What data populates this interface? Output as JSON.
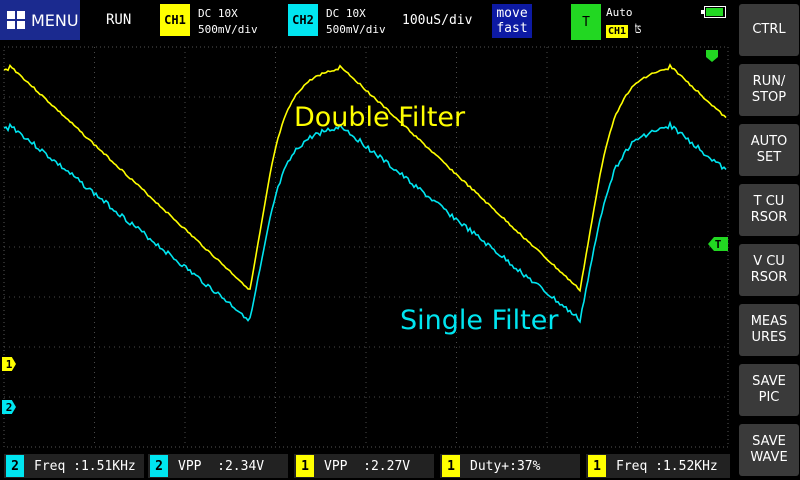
{
  "header": {
    "menu_label": "MENU",
    "run_state": "RUN",
    "ch1": {
      "badge": "CH1",
      "coupling": "DC  10X",
      "scale": "500mV/div",
      "color": "#ffff00"
    },
    "ch2": {
      "badge": "CH2",
      "coupling": "DC  10X",
      "scale": "500mV/div",
      "color": "#00e5f0"
    },
    "timebase": "100uS/div",
    "move_mode": [
      "move",
      "fast"
    ],
    "trigger": {
      "badge": "T",
      "mode": "Auto",
      "channel": "CH1",
      "edge_symbol": "ʦ",
      "color": "#22d722"
    }
  },
  "screen": {
    "labels": {
      "double": "Double Filter",
      "single": "Single Filter"
    },
    "markers": {
      "ch1": "1",
      "ch2": "2",
      "trigger": "T"
    }
  },
  "sidebar": {
    "buttons": [
      {
        "id": "ctrl",
        "label": "CTRL"
      },
      {
        "id": "run-stop",
        "label": "RUN/\nSTOP"
      },
      {
        "id": "auto-set",
        "label": "AUTO\nSET"
      },
      {
        "id": "t-cursor",
        "label": "T CU\nRSOR"
      },
      {
        "id": "v-cursor",
        "label": "V CU\nRSOR"
      },
      {
        "id": "measures",
        "label": "MEAS\nURES"
      },
      {
        "id": "save-pic",
        "label": "SAVE\nPIC"
      },
      {
        "id": "save-wave",
        "label": "SAVE\nWAVE"
      }
    ]
  },
  "measurements": [
    {
      "ch": "2",
      "text": "Freq :1.51KHz"
    },
    {
      "ch": "2",
      "text": "VPP  :2.34V"
    },
    {
      "ch": "1",
      "text": "VPP  :2.27V"
    },
    {
      "ch": "1",
      "text": "Duty+:37%"
    },
    {
      "ch": "1",
      "text": "Freq :1.52KHz"
    }
  ]
}
